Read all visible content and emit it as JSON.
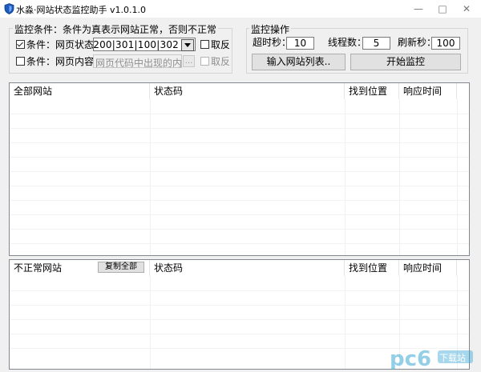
{
  "window": {
    "title": "水淼·网站状态监控助手 v1.0.1.0",
    "minimize": "—",
    "maximize": "□",
    "close": "✕"
  },
  "conditions": {
    "legend": "监控条件：条件为真表示网站正常，否则不正常",
    "status_condition": {
      "label": "条件：网页状态",
      "checked": true,
      "value": "200|301|100|302",
      "reverse_label": "取反"
    },
    "content_condition": {
      "label": "条件：网页内容",
      "checked": false,
      "placeholder": "网页代码中出现的内容",
      "browse_label": "...",
      "reverse_label": "取反"
    }
  },
  "operations": {
    "legend": "监控操作",
    "timeout_label": "超时秒：",
    "timeout_value": "10",
    "threads_label": "线程数：",
    "threads_value": "5",
    "refresh_label": "刷新秒：",
    "refresh_value": "100",
    "import_button": "输入网站列表..",
    "start_button": "开始监控"
  },
  "all_sites_table": {
    "columns": [
      "全部网站",
      "状态码",
      "找到位置",
      "响应时间"
    ]
  },
  "abnormal_sites_table": {
    "columns": [
      "不正常网站",
      "状态码",
      "找到位置",
      "响应时间"
    ],
    "copy_all_button": "复制全部"
  },
  "watermark": {
    "text": "pc6",
    "sub": "下载站"
  },
  "colors": {
    "window_bg": "#f0f0f0",
    "list_bg": "#ffffff",
    "border": "#828790",
    "watermark": "#3ca7d6"
  }
}
